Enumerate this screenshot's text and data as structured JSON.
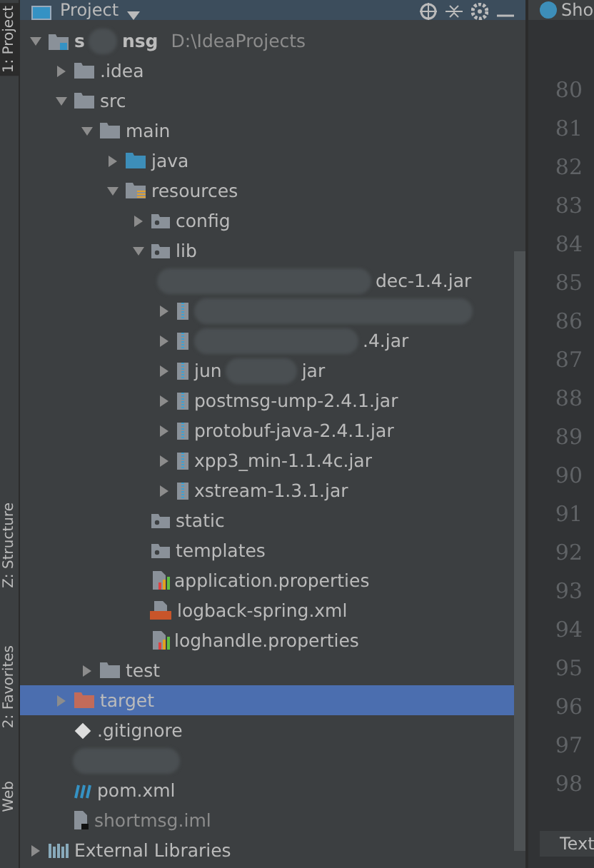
{
  "tool_stripe": [
    {
      "label": "1: Project",
      "selected": true
    },
    {
      "label": "Z: Structure",
      "selected": false
    },
    {
      "label": "2: Favorites",
      "selected": false
    },
    {
      "label": "Web",
      "selected": false
    }
  ],
  "panel": {
    "title": "Project"
  },
  "editor_tab": {
    "label": "Sho"
  },
  "tree": [
    {
      "kind": "module",
      "name": "s",
      "name_tail": "nsg",
      "path": "D:\\IdeaProjects",
      "expanded": true,
      "children": [
        {
          "kind": "folder",
          "name": ".idea",
          "expanded": false
        },
        {
          "kind": "folder",
          "name": "src",
          "expanded": true,
          "children": [
            {
              "kind": "folder",
              "name": "main",
              "expanded": true,
              "children": [
                {
                  "kind": "source",
                  "name": "java",
                  "expanded": false
                },
                {
                  "kind": "resources",
                  "name": "resources",
                  "expanded": true,
                  "children": [
                    {
                      "kind": "package",
                      "name": "config",
                      "expanded": false
                    },
                    {
                      "kind": "package",
                      "name": "lib",
                      "expanded": true,
                      "children": [
                        {
                          "kind": "jar-hidden",
                          "name": "dec-1.4.jar"
                        },
                        {
                          "kind": "jar-hidden-arrow"
                        },
                        {
                          "kind": "jar-hidden-arrow",
                          "name": ".4.jar"
                        },
                        {
                          "kind": "jar",
                          "name": "jun",
                          "name_tail": "jar",
                          "expanded": false
                        },
                        {
                          "kind": "jar",
                          "name": "postmsg-ump-2.4.1.jar",
                          "expanded": false
                        },
                        {
                          "kind": "jar",
                          "name": "protobuf-java-2.4.1.jar",
                          "expanded": false
                        },
                        {
                          "kind": "jar",
                          "name": "xpp3_min-1.1.4c.jar",
                          "expanded": false
                        },
                        {
                          "kind": "jar",
                          "name": "xstream-1.3.1.jar",
                          "expanded": false
                        }
                      ]
                    },
                    {
                      "kind": "package",
                      "name": "static"
                    },
                    {
                      "kind": "package",
                      "name": "templates"
                    },
                    {
                      "kind": "properties",
                      "name": "application.properties"
                    },
                    {
                      "kind": "xml",
                      "name": "logback-spring.xml"
                    },
                    {
                      "kind": "properties",
                      "name": "loghandle.properties"
                    }
                  ]
                }
              ]
            },
            {
              "kind": "folder",
              "name": "test",
              "expanded": false
            }
          ]
        },
        {
          "kind": "excluded",
          "name": "target",
          "expanded": false,
          "selected": true
        },
        {
          "kind": "git",
          "name": ".gitignore"
        },
        {
          "kind": "hidden"
        },
        {
          "kind": "maven",
          "name": "pom.xml"
        },
        {
          "kind": "iml",
          "name": "shortmsg.iml"
        }
      ]
    },
    {
      "kind": "libraries",
      "name": "External Libraries",
      "expanded": false
    }
  ],
  "gutter": {
    "line_numbers": [
      "80",
      "81",
      "82",
      "83",
      "84",
      "85",
      "86",
      "87",
      "88",
      "89",
      "90",
      "91",
      "92",
      "93",
      "94",
      "95",
      "96",
      "97",
      "98"
    ]
  },
  "bottom_tab": {
    "label": "Text"
  }
}
